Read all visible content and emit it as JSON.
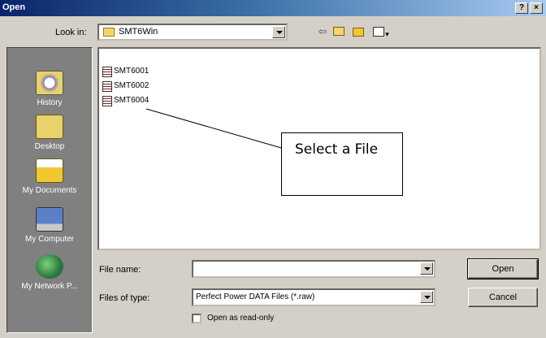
{
  "window": {
    "title": "Open",
    "help_label": "?",
    "close_label": "×"
  },
  "toolbar": {
    "lookin_label": "Look in:",
    "lookin_value": "SMT6Win",
    "back_glyph": "⇦",
    "views_glyph": "▾"
  },
  "places": [
    {
      "label": "History",
      "icon": "history-icon"
    },
    {
      "label": "Desktop",
      "icon": "desktop-icon"
    },
    {
      "label": "My Documents",
      "icon": "my-documents-icon"
    },
    {
      "label": "My Computer",
      "icon": "my-computer-icon"
    },
    {
      "label": "My Network P...",
      "icon": "network-places-icon"
    }
  ],
  "files": [
    {
      "name": "SMT6001"
    },
    {
      "name": "SMT6002"
    },
    {
      "name": "SMT6004"
    }
  ],
  "callout": {
    "text": "Select a File"
  },
  "form": {
    "filename_label": "File name:",
    "filename_value": "",
    "filetype_label": "Files of type:",
    "filetype_value": "Perfect Power DATA Files (*.raw)",
    "readonly_label": "Open as read-only",
    "readonly_checked": false
  },
  "buttons": {
    "open": "Open",
    "cancel": "Cancel"
  }
}
